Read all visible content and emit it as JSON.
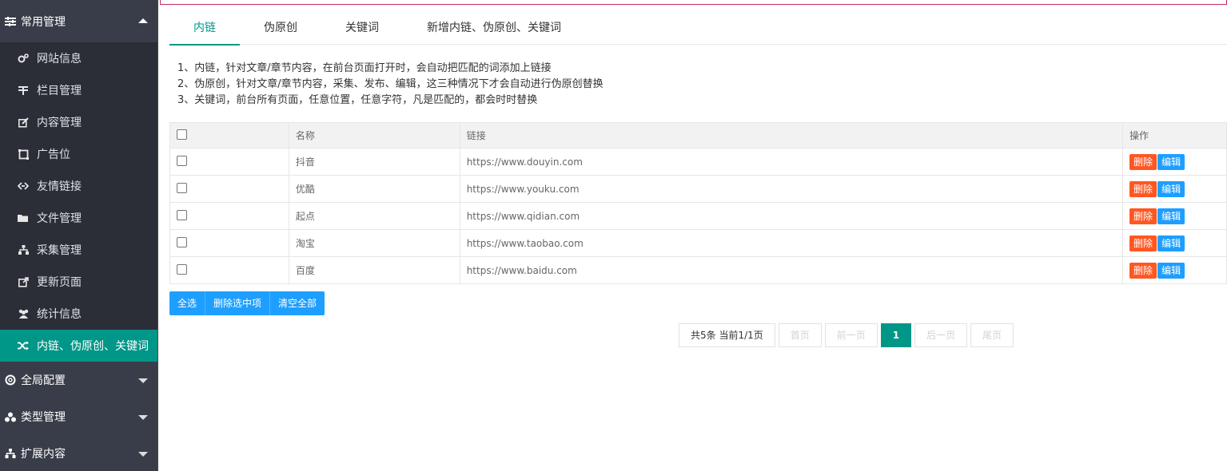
{
  "sidebar": {
    "group_main": {
      "label": "常用管理",
      "icon": "sliders-icon"
    },
    "items": [
      {
        "label": "网站信息",
        "icon": "cogs-icon"
      },
      {
        "label": "栏目管理",
        "icon": "column-icon"
      },
      {
        "label": "内容管理",
        "icon": "edit-icon"
      },
      {
        "label": "广告位",
        "icon": "frame-icon"
      },
      {
        "label": "友情链接",
        "icon": "link-icon"
      },
      {
        "label": "文件管理",
        "icon": "folder-icon"
      },
      {
        "label": "采集管理",
        "icon": "sitemap-icon"
      },
      {
        "label": "更新页面",
        "icon": "external-link-icon"
      },
      {
        "label": "统计信息",
        "icon": "users-icon"
      },
      {
        "label": "内链、伪原创、关键词",
        "icon": "shuffle-icon"
      }
    ],
    "groups": [
      {
        "label": "全局配置",
        "icon": "lifebuoy-icon"
      },
      {
        "label": "类型管理",
        "icon": "cubes-icon"
      },
      {
        "label": "扩展内容",
        "icon": "sitemap-icon"
      }
    ]
  },
  "tabs": [
    "内链",
    "伪原创",
    "关键词",
    "新增内链、伪原创、关键词"
  ],
  "notes": [
    "1、内链，针对文章/章节内容，在前台页面打开时，会自动把匹配的词添加上链接",
    "2、伪原创，针对文章/章节内容，采集、发布、编辑，这三种情况下才会自动进行伪原创替换",
    "3、关键词，前台所有页面，任意位置，任意字符，凡是匹配的，都会时时替换"
  ],
  "table": {
    "headers": {
      "name": "名称",
      "link": "链接",
      "ops": "操作"
    },
    "rows": [
      {
        "name": "抖音",
        "link": "https://www.douyin.com"
      },
      {
        "name": "优酷",
        "link": "https://www.youku.com"
      },
      {
        "name": "起点",
        "link": "https://www.qidian.com"
      },
      {
        "name": "淘宝",
        "link": "https://www.taobao.com"
      },
      {
        "name": "百度",
        "link": "https://www.baidu.com"
      }
    ],
    "delete_label": "删除",
    "edit_label": "编辑"
  },
  "bulk": {
    "select_all": "全选",
    "delete_selected": "删除选中项",
    "clear_all": "清空全部"
  },
  "pager": {
    "info": "共5条 当前1/1页",
    "first": "首页",
    "prev": "前一页",
    "current": "1",
    "next": "后一页",
    "last": "尾页"
  },
  "colors": {
    "accent": "#009688",
    "danger": "#ff5722",
    "primary": "#1e9fff",
    "sidebar": "#393d49"
  }
}
